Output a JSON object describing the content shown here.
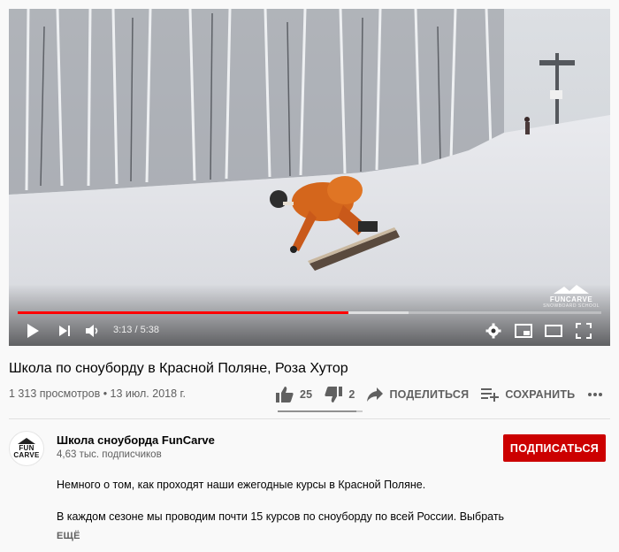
{
  "player": {
    "time_current": "3:13",
    "time_separator": " / ",
    "time_total": "5:38",
    "progress_played": 0.566,
    "progress_buffered": 0.67,
    "watermark": "FUNCARVE",
    "watermark_sub": "SNOWBOARD SCHOOL",
    "icons": [
      "play-icon",
      "next-icon",
      "volume-icon",
      "settings-icon",
      "miniplayer-icon",
      "theater-icon",
      "fullscreen-icon"
    ]
  },
  "video": {
    "title": "Школа по сноуборду в Красной Поляне, Роза Хутор",
    "views": "1 313 просмотров",
    "dot": " • ",
    "date": "13 июл. 2018 г.",
    "likes": "25",
    "dislikes": "2",
    "like_ratio": 0.926,
    "share_label": "ПОДЕЛИТЬСЯ",
    "save_label": "СОХРАНИТЬ",
    "more_icon": "more-horizontal-icon"
  },
  "channel": {
    "avatar_line1": "FUN",
    "avatar_line2": "CARVE",
    "name": "Школа сноуборда FunCarve",
    "subscribers": "4,63 тыс. подписчиков",
    "subscribe_label": "ПОДПИСАТЬСЯ"
  },
  "description": {
    "line1": "Немного о том, как проходят наши ежегодные курсы в Красной Поляне.",
    "line2": "В каждом сезоне мы проводим почти 15 курсов по сноуборду по всей России. Выбрать",
    "more_label": "ЕЩЁ"
  },
  "colors": {
    "progress": "#ff0000",
    "subscribe": "#cc0000",
    "secondary_text": "#606060"
  }
}
